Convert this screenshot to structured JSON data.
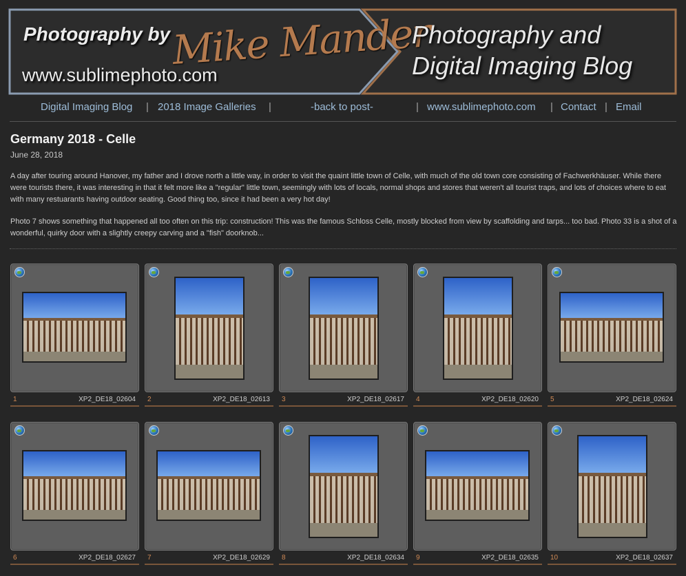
{
  "banner": {
    "photography_by": "Photography by",
    "signature": "Mike Mander",
    "url": "www.sublimephoto.com",
    "blog_title_line1": "Photography and",
    "blog_title_line2": "Digital Imaging Blog",
    "left_border_color": "#8a9bb0",
    "right_border_color": "#a0704a"
  },
  "nav": {
    "items": [
      {
        "label": "Digital Imaging Blog"
      },
      {
        "label": "2018 Image Galleries"
      },
      {
        "label": "-back to post-"
      },
      {
        "label": "www.sublimephoto.com"
      },
      {
        "label": "Contact"
      },
      {
        "label": "Email"
      }
    ],
    "separator": "|"
  },
  "post": {
    "title": "Germany 2018 - Celle",
    "date": "June 28, 2018",
    "paragraph1": "A day after touring around Hanover, my father and I drove north a little way, in order to visit the quaint little town of Celle, with much of the old town core consisting of Fachwerkhäuser. While there were tourists there, it was interesting in that it felt more like a \"regular\" little town, seemingly with lots of locals, normal shops and stores that weren't all tourist traps, and lots of choices where to eat with many restuarants having outdoor seating. Good thing too, since it had been a very hot day!",
    "paragraph2": "Photo 7 shows something that happened all too often on this trip: construction! This was the famous Schloss Celle, mostly blocked from view by scaffolding and tarps... too bad. Photo 33 is a shot of a wonderful, quirky door with a slightly creepy carving and a \"fish\" doorknob..."
  },
  "gallery": {
    "items": [
      {
        "num": "1",
        "name": "XP2_DE18_02604",
        "orientation": "landscape"
      },
      {
        "num": "2",
        "name": "XP2_DE18_02613",
        "orientation": "portrait"
      },
      {
        "num": "3",
        "name": "XP2_DE18_02617",
        "orientation": "portrait"
      },
      {
        "num": "4",
        "name": "XP2_DE18_02620",
        "orientation": "portrait"
      },
      {
        "num": "5",
        "name": "XP2_DE18_02624",
        "orientation": "landscape"
      },
      {
        "num": "6",
        "name": "XP2_DE18_02627",
        "orientation": "landscape"
      },
      {
        "num": "7",
        "name": "XP2_DE18_02629",
        "orientation": "landscape"
      },
      {
        "num": "8",
        "name": "XP2_DE18_02634",
        "orientation": "portrait"
      },
      {
        "num": "9",
        "name": "XP2_DE18_02635",
        "orientation": "landscape"
      },
      {
        "num": "10",
        "name": "XP2_DE18_02637",
        "orientation": "portrait"
      }
    ]
  }
}
